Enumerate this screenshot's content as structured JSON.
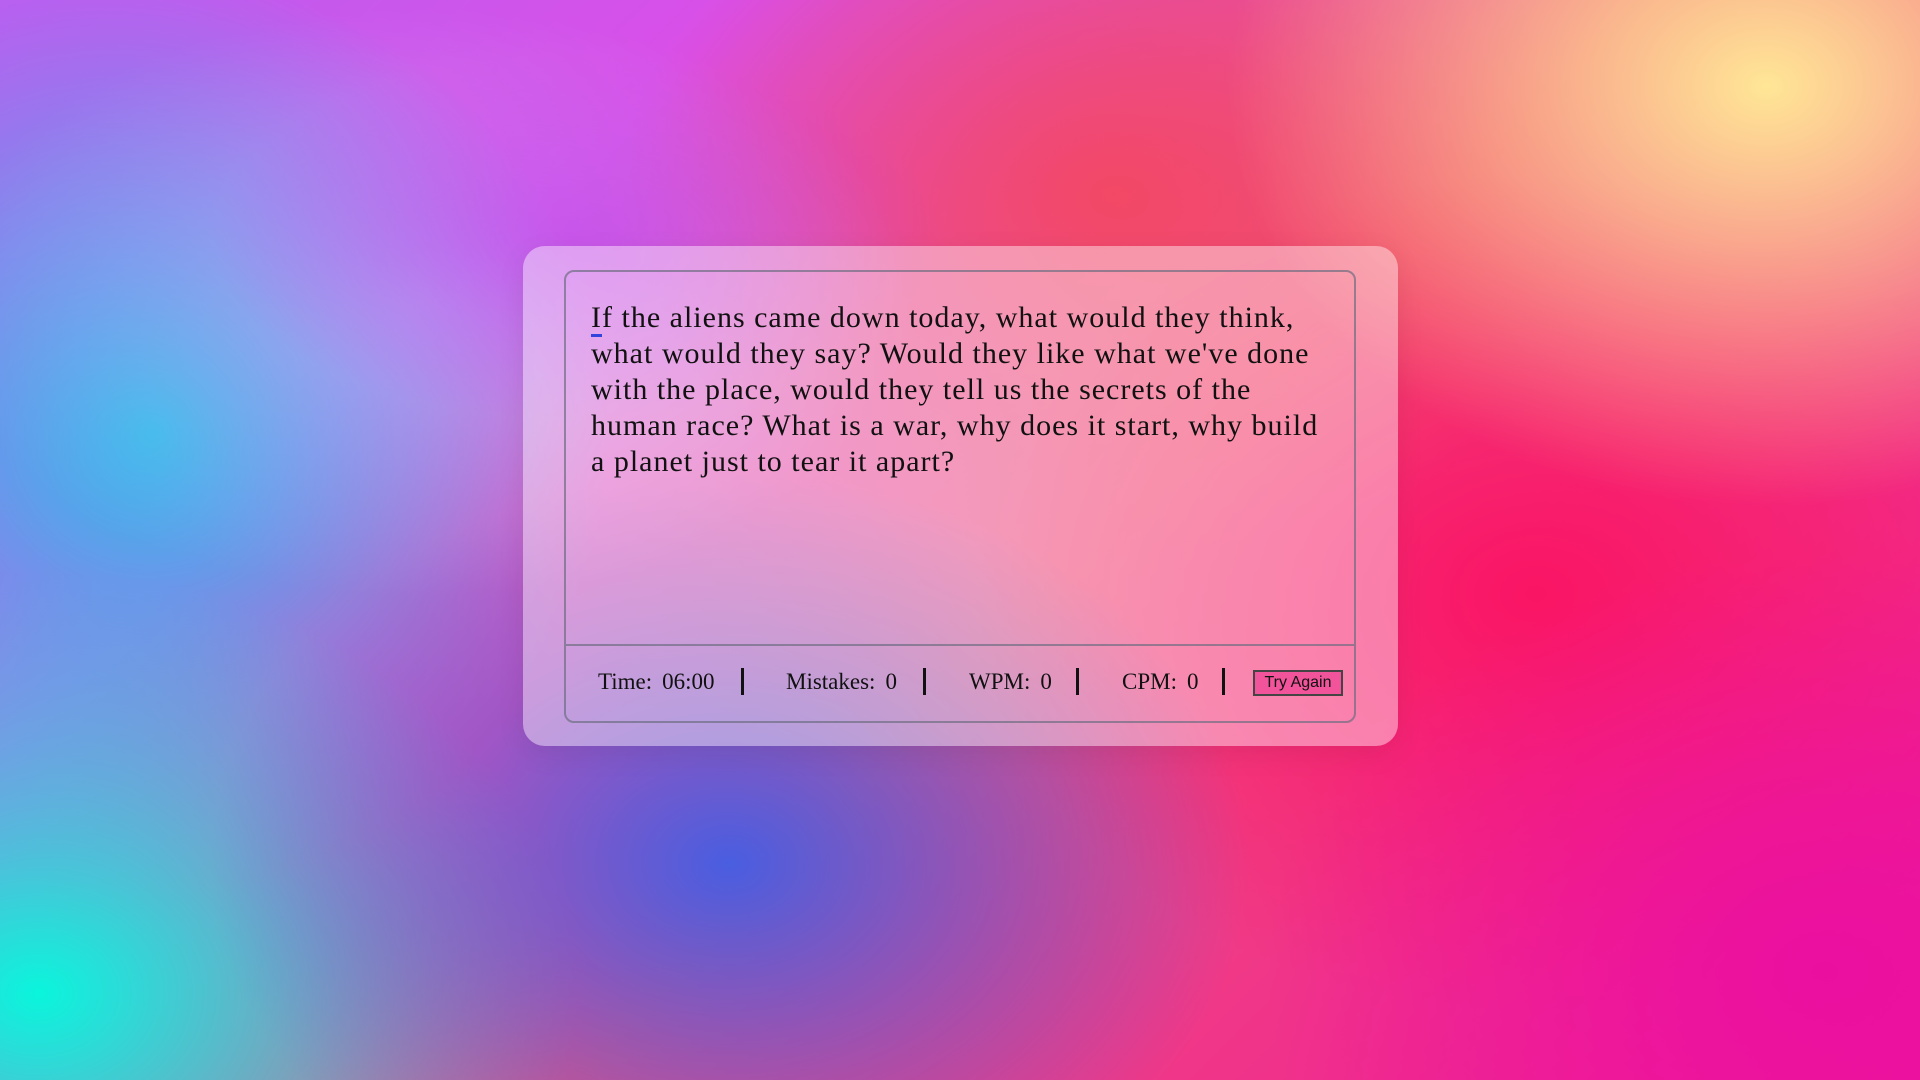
{
  "typing": {
    "active_char": "I",
    "rest_text": "f the aliens came down today, what would they think, what would they say? Would they like what we've done with the place, would they tell us the secrets of the human race? What is a war, why does it start, why build a planet just to tear it apart?"
  },
  "stats": {
    "time_label": "Time:",
    "time_value": "06:00",
    "mistakes_label": "Mistakes:",
    "mistakes_value": "0",
    "wpm_label": "WPM:",
    "wpm_value": "0",
    "cpm_label": "CPM:",
    "cpm_value": "0"
  },
  "buttons": {
    "try_again_label": "Try Again"
  },
  "colors": {
    "button_bg": "#f1549a",
    "cursor_underline": "#3344dd"
  }
}
